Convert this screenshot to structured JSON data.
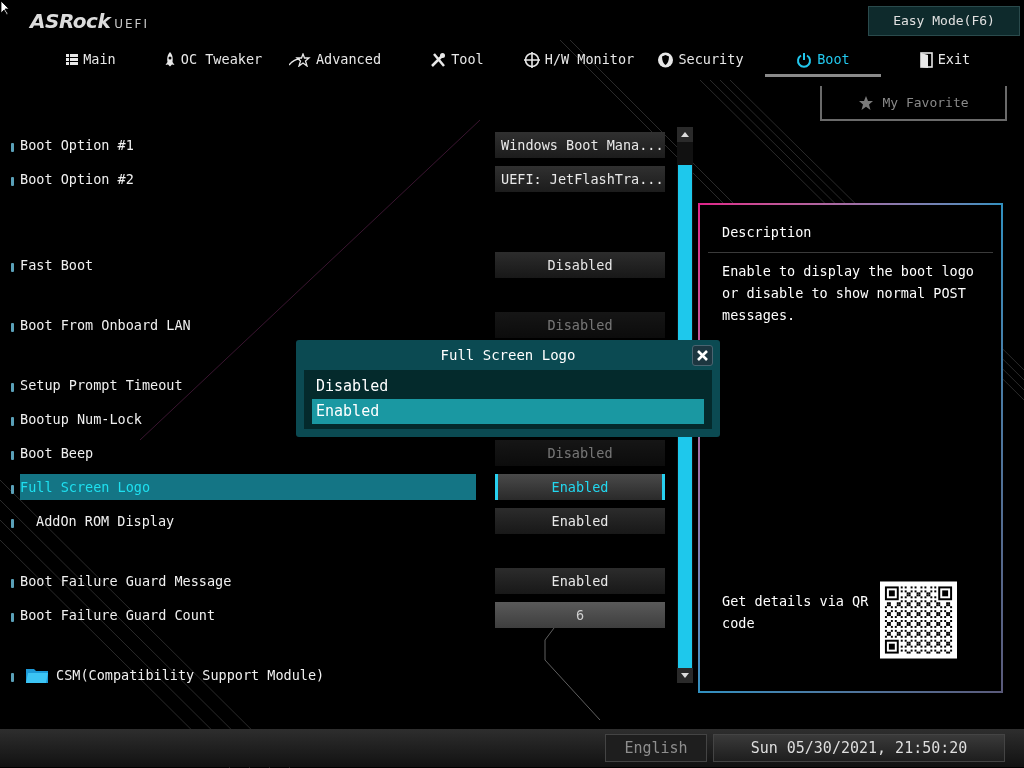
{
  "logo": {
    "brand": "ASRock",
    "suffix": "UEFI"
  },
  "easy_mode_button": "Easy Mode(F6)",
  "tabs": [
    {
      "label": "Main",
      "selected": false
    },
    {
      "label": "OC Tweaker",
      "selected": false
    },
    {
      "label": "Advanced",
      "selected": false
    },
    {
      "label": "Tool",
      "selected": false
    },
    {
      "label": "H/W Monitor",
      "selected": false
    },
    {
      "label": "Security",
      "selected": false
    },
    {
      "label": "Boot",
      "selected": true
    },
    {
      "label": "Exit",
      "selected": false
    }
  ],
  "favorite_button": "My Favorite",
  "groups": [
    [
      {
        "kind": "option",
        "label": "Boot Option #1",
        "selected": false,
        "value": {
          "kind": "text",
          "text": "Windows Boot Mana..."
        }
      },
      {
        "kind": "option",
        "label": "Boot Option #2",
        "selected": false,
        "value": {
          "kind": "text",
          "text": "UEFI: JetFlashTra..."
        }
      }
    ],
    [
      {
        "kind": "option",
        "label": "Fast Boot",
        "selected": false,
        "value": {
          "kind": "toggle",
          "text": "Disabled"
        }
      }
    ],
    [
      {
        "kind": "option",
        "label": "Boot From Onboard LAN",
        "selected": false,
        "value": {
          "kind": "toggle",
          "text": "Disabled",
          "dimmed": true
        }
      }
    ],
    [
      {
        "kind": "option",
        "label": "Setup Prompt Timeout",
        "selected": false
      },
      {
        "kind": "option",
        "label": "Bootup Num-Lock",
        "selected": false
      },
      {
        "kind": "option",
        "label": "Boot Beep",
        "selected": false,
        "value": {
          "kind": "toggle",
          "text": "Disabled",
          "dimmed": true
        }
      },
      {
        "kind": "option",
        "label": "Full Screen Logo",
        "selected": true,
        "value": {
          "kind": "toggle",
          "text": "Enabled"
        },
        "children": [
          {
            "kind": "option",
            "label": "AddOn ROM Display",
            "selected": false,
            "value": {
              "kind": "toggle",
              "text": "Enabled"
            }
          }
        ]
      }
    ],
    [
      {
        "kind": "option",
        "label": "Boot Failure Guard Message",
        "selected": false,
        "value": {
          "kind": "toggle",
          "text": "Enabled"
        }
      },
      {
        "kind": "option",
        "label": "Boot Failure Guard Count",
        "selected": false,
        "value": {
          "kind": "number",
          "text": "6"
        }
      }
    ],
    [
      {
        "kind": "folder",
        "label": "CSM(Compatibility Support Module)",
        "selected": false
      }
    ]
  ],
  "popup": {
    "title": "Full Screen Logo",
    "options": [
      {
        "label": "Disabled",
        "selected": false
      },
      {
        "label": "Enabled",
        "selected": true
      }
    ]
  },
  "description": {
    "title": "Description",
    "text": "Enable to display the boot logo or disable to show normal POST messages.",
    "qr_text": "Get details via QR code"
  },
  "status_bar": {
    "language": "English",
    "datetime": "Sun 05/30/2021, 21:50:20"
  }
}
